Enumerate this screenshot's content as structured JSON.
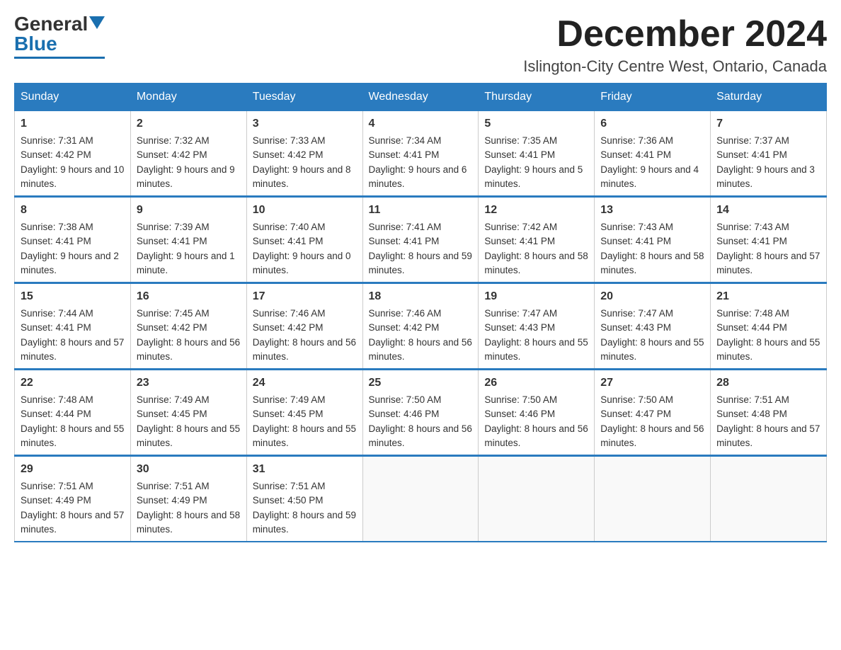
{
  "logo": {
    "general": "General",
    "blue": "Blue"
  },
  "title": "December 2024",
  "location": "Islington-City Centre West, Ontario, Canada",
  "days_of_week": [
    "Sunday",
    "Monday",
    "Tuesday",
    "Wednesday",
    "Thursday",
    "Friday",
    "Saturday"
  ],
  "weeks": [
    [
      {
        "day": "1",
        "sunrise": "7:31 AM",
        "sunset": "4:42 PM",
        "daylight": "9 hours and 10 minutes."
      },
      {
        "day": "2",
        "sunrise": "7:32 AM",
        "sunset": "4:42 PM",
        "daylight": "9 hours and 9 minutes."
      },
      {
        "day": "3",
        "sunrise": "7:33 AM",
        "sunset": "4:42 PM",
        "daylight": "9 hours and 8 minutes."
      },
      {
        "day": "4",
        "sunrise": "7:34 AM",
        "sunset": "4:41 PM",
        "daylight": "9 hours and 6 minutes."
      },
      {
        "day": "5",
        "sunrise": "7:35 AM",
        "sunset": "4:41 PM",
        "daylight": "9 hours and 5 minutes."
      },
      {
        "day": "6",
        "sunrise": "7:36 AM",
        "sunset": "4:41 PM",
        "daylight": "9 hours and 4 minutes."
      },
      {
        "day": "7",
        "sunrise": "7:37 AM",
        "sunset": "4:41 PM",
        "daylight": "9 hours and 3 minutes."
      }
    ],
    [
      {
        "day": "8",
        "sunrise": "7:38 AM",
        "sunset": "4:41 PM",
        "daylight": "9 hours and 2 minutes."
      },
      {
        "day": "9",
        "sunrise": "7:39 AM",
        "sunset": "4:41 PM",
        "daylight": "9 hours and 1 minute."
      },
      {
        "day": "10",
        "sunrise": "7:40 AM",
        "sunset": "4:41 PM",
        "daylight": "9 hours and 0 minutes."
      },
      {
        "day": "11",
        "sunrise": "7:41 AM",
        "sunset": "4:41 PM",
        "daylight": "8 hours and 59 minutes."
      },
      {
        "day": "12",
        "sunrise": "7:42 AM",
        "sunset": "4:41 PM",
        "daylight": "8 hours and 58 minutes."
      },
      {
        "day": "13",
        "sunrise": "7:43 AM",
        "sunset": "4:41 PM",
        "daylight": "8 hours and 58 minutes."
      },
      {
        "day": "14",
        "sunrise": "7:43 AM",
        "sunset": "4:41 PM",
        "daylight": "8 hours and 57 minutes."
      }
    ],
    [
      {
        "day": "15",
        "sunrise": "7:44 AM",
        "sunset": "4:41 PM",
        "daylight": "8 hours and 57 minutes."
      },
      {
        "day": "16",
        "sunrise": "7:45 AM",
        "sunset": "4:42 PM",
        "daylight": "8 hours and 56 minutes."
      },
      {
        "day": "17",
        "sunrise": "7:46 AM",
        "sunset": "4:42 PM",
        "daylight": "8 hours and 56 minutes."
      },
      {
        "day": "18",
        "sunrise": "7:46 AM",
        "sunset": "4:42 PM",
        "daylight": "8 hours and 56 minutes."
      },
      {
        "day": "19",
        "sunrise": "7:47 AM",
        "sunset": "4:43 PM",
        "daylight": "8 hours and 55 minutes."
      },
      {
        "day": "20",
        "sunrise": "7:47 AM",
        "sunset": "4:43 PM",
        "daylight": "8 hours and 55 minutes."
      },
      {
        "day": "21",
        "sunrise": "7:48 AM",
        "sunset": "4:44 PM",
        "daylight": "8 hours and 55 minutes."
      }
    ],
    [
      {
        "day": "22",
        "sunrise": "7:48 AM",
        "sunset": "4:44 PM",
        "daylight": "8 hours and 55 minutes."
      },
      {
        "day": "23",
        "sunrise": "7:49 AM",
        "sunset": "4:45 PM",
        "daylight": "8 hours and 55 minutes."
      },
      {
        "day": "24",
        "sunrise": "7:49 AM",
        "sunset": "4:45 PM",
        "daylight": "8 hours and 55 minutes."
      },
      {
        "day": "25",
        "sunrise": "7:50 AM",
        "sunset": "4:46 PM",
        "daylight": "8 hours and 56 minutes."
      },
      {
        "day": "26",
        "sunrise": "7:50 AM",
        "sunset": "4:46 PM",
        "daylight": "8 hours and 56 minutes."
      },
      {
        "day": "27",
        "sunrise": "7:50 AM",
        "sunset": "4:47 PM",
        "daylight": "8 hours and 56 minutes."
      },
      {
        "day": "28",
        "sunrise": "7:51 AM",
        "sunset": "4:48 PM",
        "daylight": "8 hours and 57 minutes."
      }
    ],
    [
      {
        "day": "29",
        "sunrise": "7:51 AM",
        "sunset": "4:49 PM",
        "daylight": "8 hours and 57 minutes."
      },
      {
        "day": "30",
        "sunrise": "7:51 AM",
        "sunset": "4:49 PM",
        "daylight": "8 hours and 58 minutes."
      },
      {
        "day": "31",
        "sunrise": "7:51 AM",
        "sunset": "4:50 PM",
        "daylight": "8 hours and 59 minutes."
      },
      null,
      null,
      null,
      null
    ]
  ]
}
